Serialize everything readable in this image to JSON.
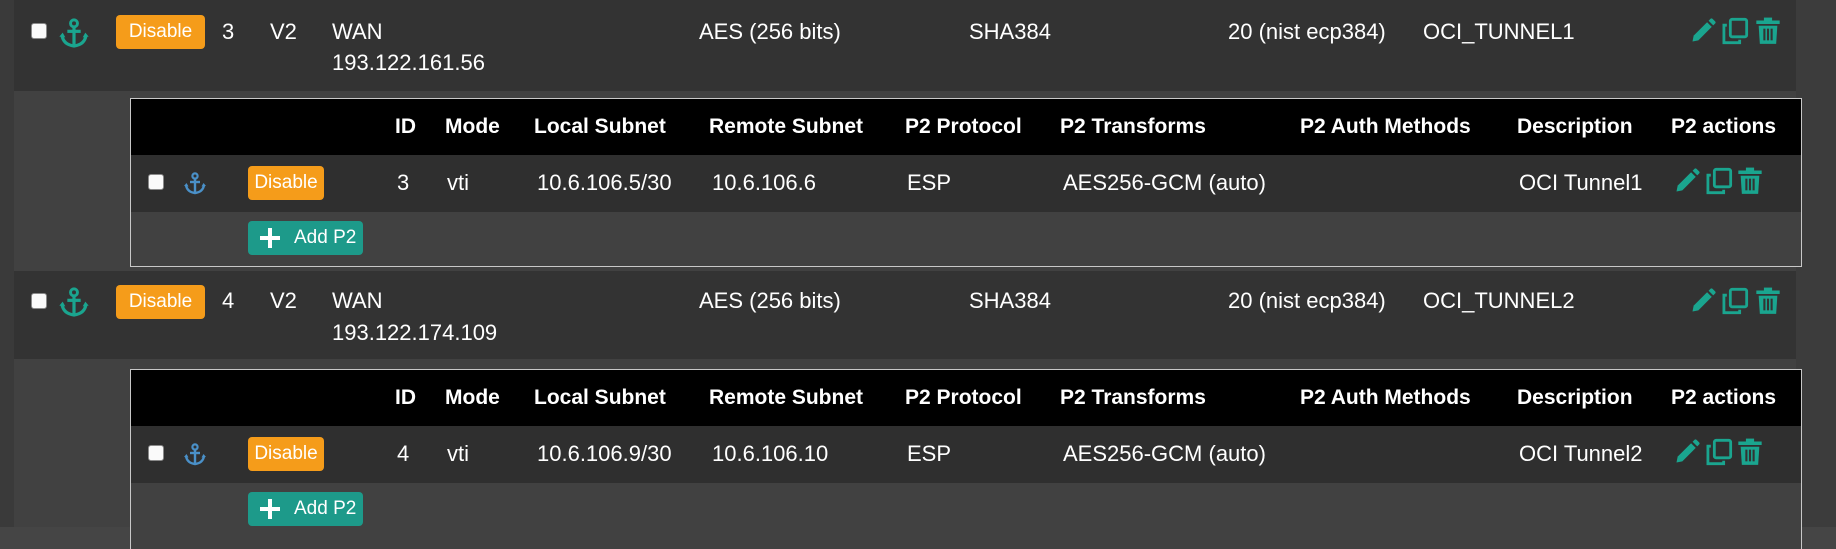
{
  "colors": {
    "disable_badge": "#f59c1a",
    "action_icon": "#1aa58f",
    "p1_anchor": "#1aa58f",
    "p2_anchor": "#4a90c8",
    "add_button": "#1d9a8a"
  },
  "p2_headers": {
    "id": "ID",
    "mode": "Mode",
    "local_subnet": "Local Subnet",
    "remote_subnet": "Remote Subnet",
    "p2_protocol": "P2 Protocol",
    "p2_transforms": "P2 Transforms",
    "p2_auth_methods": "P2 Auth Methods",
    "description": "Description",
    "p2_actions": "P2 actions"
  },
  "tunnels": [
    {
      "p1": {
        "disable_label": "Disable",
        "id": "3",
        "version": "V2",
        "interface": "WAN",
        "remote_gateway": "193.122.161.56",
        "encryption": "AES (256 bits)",
        "hash": "SHA384",
        "dh_group": "20 (nist ecp384)",
        "description": "OCI_TUNNEL1",
        "icons": [
          "anchor-icon",
          "edit-icon",
          "copy-icon",
          "delete-icon"
        ]
      },
      "p2": {
        "disable_label": "Disable",
        "id": "3",
        "mode": "vti",
        "local_subnet": "10.6.106.5/30",
        "remote_subnet": "10.6.106.6",
        "protocol": "ESP",
        "transforms": "AES256-GCM (auto)",
        "auth_methods": "",
        "description": "OCI Tunnel1",
        "icons": [
          "anchor-icon",
          "edit-icon",
          "copy-icon",
          "delete-icon"
        ]
      },
      "add_p2_label": "Add P2"
    },
    {
      "p1": {
        "disable_label": "Disable",
        "id": "4",
        "version": "V2",
        "interface": "WAN",
        "remote_gateway": "193.122.174.109",
        "encryption": "AES (256 bits)",
        "hash": "SHA384",
        "dh_group": "20 (nist ecp384)",
        "description": "OCI_TUNNEL2",
        "icons": [
          "anchor-icon",
          "edit-icon",
          "copy-icon",
          "delete-icon"
        ]
      },
      "p2": {
        "disable_label": "Disable",
        "id": "4",
        "mode": "vti",
        "local_subnet": "10.6.106.9/30",
        "remote_subnet": "10.6.106.10",
        "protocol": "ESP",
        "transforms": "AES256-GCM (auto)",
        "auth_methods": "",
        "description": "OCI Tunnel2",
        "icons": [
          "anchor-icon",
          "edit-icon",
          "copy-icon",
          "delete-icon"
        ]
      },
      "add_p2_label": "Add P2"
    }
  ]
}
